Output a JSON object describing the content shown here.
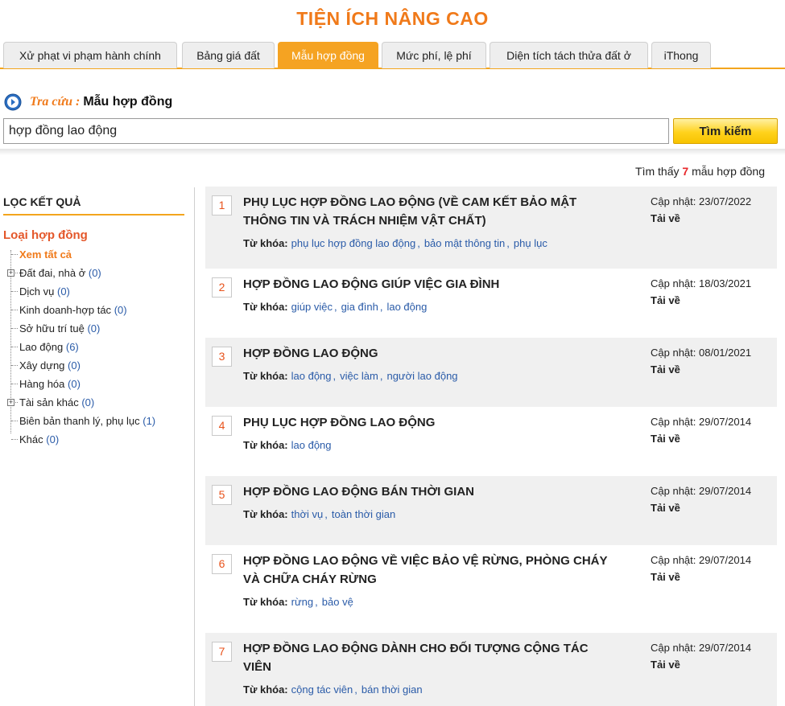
{
  "page_title": "TIỆN ÍCH NÂNG CAO",
  "tabs": [
    {
      "label": "Xử phạt vi phạm hành chính"
    },
    {
      "label": "Bảng giá đất"
    },
    {
      "label": "Mẫu hợp đồng"
    },
    {
      "label": "Mức phí, lệ phí"
    },
    {
      "label": "Diện tích tách thửa đất ở"
    },
    {
      "label": "iThong"
    }
  ],
  "active_tab": "Mẫu hợp đồng",
  "lookup": {
    "prefix": "Tra cứu :",
    "title": "Mẫu hợp đồng"
  },
  "search": {
    "value": "hợp đồng lao động",
    "button_label": "Tìm kiếm"
  },
  "summary": {
    "before": "Tìm thấy",
    "count": "7",
    "after": "mẫu hợp đồng"
  },
  "sidebar": {
    "heading": "LỌC KẾT QUẢ",
    "group_title": "Loại hợp đồng",
    "view_all": "Xem tất cả",
    "items": [
      {
        "label": "Đất đai, nhà ở",
        "count": "(0)",
        "expandable": true
      },
      {
        "label": "Dịch vụ",
        "count": "(0)",
        "expandable": false
      },
      {
        "label": "Kinh doanh-hợp tác",
        "count": "(0)",
        "expandable": false
      },
      {
        "label": "Sở hữu trí tuệ",
        "count": "(0)",
        "expandable": false
      },
      {
        "label": "Lao động",
        "count": "(6)",
        "expandable": false
      },
      {
        "label": "Xây dựng",
        "count": "(0)",
        "expandable": false
      },
      {
        "label": "Hàng hóa",
        "count": "(0)",
        "expandable": false
      },
      {
        "label": "Tài sản khác",
        "count": "(0)",
        "expandable": true
      },
      {
        "label": "Biên bản thanh lý, phụ lục",
        "count": "(1)",
        "expandable": false
      },
      {
        "label": "Khác",
        "count": "(0)",
        "expandable": false
      }
    ]
  },
  "labels": {
    "keywords": "Từ khóa:",
    "updated": "Cập nhật:",
    "download": "Tải về"
  },
  "results": [
    {
      "num": "1",
      "title_lines": [
        "PHỤ LỤC HỢP ĐỒNG LAO ĐỘNG (VỀ CAM KẾT BẢO MẬT",
        "THÔNG TIN VÀ TRÁCH NHIỆM VẬT CHẤT)"
      ],
      "keywords": [
        "phụ lục hợp đồng lao động",
        "bảo mật thông tin",
        "phụ lục"
      ],
      "updated": "23/07/2022"
    },
    {
      "num": "2",
      "title_lines": [
        "HỢP ĐỒNG LAO ĐỘNG GIÚP VIỆC GIA ĐÌNH"
      ],
      "keywords": [
        "giúp việc",
        "gia đình",
        "lao động"
      ],
      "updated": "18/03/2021"
    },
    {
      "num": "3",
      "title_lines": [
        "HỢP ĐỒNG LAO ĐỘNG"
      ],
      "keywords": [
        "lao động",
        "việc làm",
        "người lao động"
      ],
      "updated": "08/01/2021"
    },
    {
      "num": "4",
      "title_lines": [
        "PHỤ LỤC HỢP ĐỒNG LAO ĐỘNG"
      ],
      "keywords": [
        "lao động"
      ],
      "updated": "29/07/2014"
    },
    {
      "num": "5",
      "title_lines": [
        "HỢP ĐỒNG LAO ĐỘNG BÁN THỜI GIAN"
      ],
      "keywords": [
        "thời vụ",
        "toàn thời gian"
      ],
      "updated": "29/07/2014"
    },
    {
      "num": "6",
      "title_lines": [
        "HỢP ĐỒNG LAO ĐỘNG VỀ VIỆC BẢO VỆ RỪNG, PHÒNG CHÁY",
        "VÀ CHỮA CHÁY RỪNG"
      ],
      "keywords": [
        "rừng",
        "bảo vệ"
      ],
      "updated": "29/07/2014"
    },
    {
      "num": "7",
      "title_lines": [
        "HỢP ĐỒNG LAO ĐỘNG DÀNH CHO ĐỐI TƯỢNG CỘNG TÁC",
        "VIÊN"
      ],
      "keywords": [
        "cộng tác viên",
        "bán thời gian"
      ],
      "updated": "29/07/2014"
    }
  ],
  "colors": {
    "accent_orange": "#f07a1a",
    "tab_active": "#f5a322",
    "link_blue": "#2a5ba8",
    "count_red": "#e8272b",
    "button_yellow": "#ffd21c"
  }
}
